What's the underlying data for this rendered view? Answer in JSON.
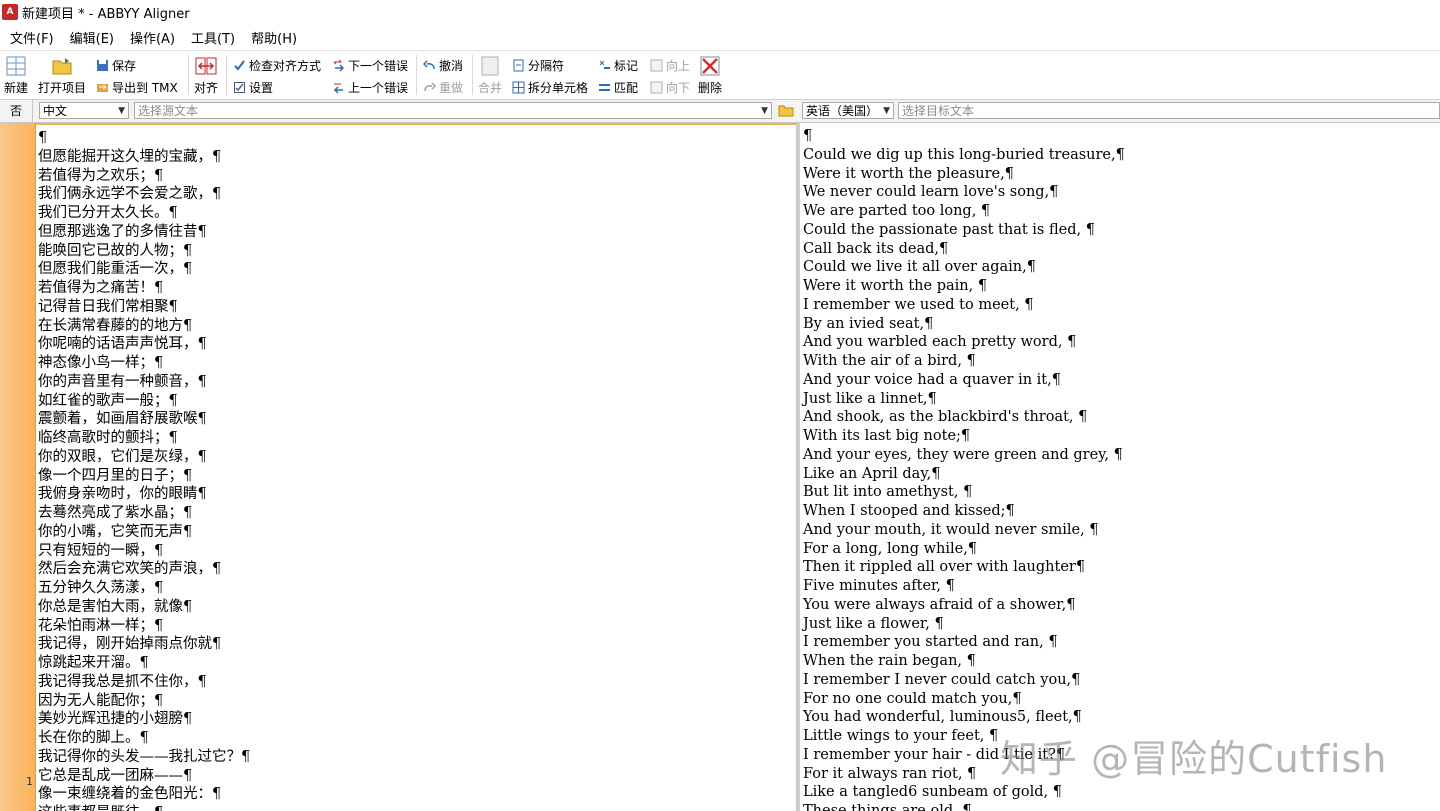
{
  "window": {
    "title": "新建项目 * - ABBYY Aligner",
    "icon": "app-icon"
  },
  "menu": [
    "文件(F)",
    "编辑(E)",
    "操作(A)",
    "工具(T)",
    "帮助(H)"
  ],
  "toolbar": {
    "new": "新建",
    "open": "打开项目",
    "save": "保存",
    "export_tmx": "导出到 TMX",
    "align": "对齐",
    "check_alignment": "检查对齐方式",
    "settings": "设置",
    "next_error": "下一个错误",
    "prev_error": "上一个错误",
    "undo": "撤消",
    "redo": "重做",
    "merge": "合并",
    "separator": "分隔符",
    "split_cells": "拆分单元格",
    "mark": "标记",
    "match": "匹配",
    "up": "向上",
    "down": "向下",
    "delete": "删除"
  },
  "selector": {
    "no_label": "否",
    "source_lang": "中文",
    "source_placeholder": "选择源文本",
    "target_lang": "英语（美国）",
    "target_placeholder": "选择目标文本"
  },
  "row_number": "1",
  "source_lines": [
    "¶",
    "但愿能掘开这久埋的宝藏，¶",
    "若值得为之欢乐；¶",
    "我们俩永远学不会爱之歌，¶",
    "我们已分开太久长。¶",
    "但愿那逃逸了的多情往昔¶",
    "能唤回它已故的人物；¶",
    "但愿我们能重活一次，¶",
    "若值得为之痛苦！¶",
    "记得昔日我们常相聚¶",
    "在长满常春藤的的地方¶",
    "你呢喃的话语声声悦耳，¶",
    "神态像小鸟一样；¶",
    "你的声音里有一种颤音，¶",
    "如红雀的歌声一般；¶",
    "震颤着，如画眉舒展歌喉¶",
    "临终高歌时的颤抖；¶",
    "你的双眼，它们是灰绿，¶",
    "像一个四月里的日子；¶",
    "我俯身亲吻时，你的眼睛¶",
    "去蓦然亮成了紫水晶；¶",
    "你的小嘴，它笑而无声¶",
    "只有短短的一瞬，¶",
    "然后会充满它欢笑的声浪，¶",
    "五分钟久久荡漾，¶",
    "你总是害怕大雨，就像¶",
    "花朵怕雨淋一样；¶",
    "我记得，刚开始掉雨点你就¶",
    "惊跳起来开溜。¶",
    "我记得我总是抓不住你，¶",
    "因为无人能配你；¶",
    "美妙光辉迅捷的小翅膀¶",
    "长在你的脚上。¶",
    "我记得你的头发——我扎过它？¶",
    "它总是乱成一团麻——¶",
    "像一束缠绕着的金色阳光：¶",
    "这些事都是既往。¶"
  ],
  "target_lines": [
    "¶",
    "Could we dig up this long-buried treasure,¶",
    "Were it worth the pleasure,¶",
    "We never could learn love's song,¶",
    "We are parted too long, ¶",
    "Could the passionate past that is fled, ¶",
    "Call back its dead,¶",
    "Could we live it all over again,¶",
    "Were it worth the pain, ¶",
    "I remember we used to meet, ¶",
    "By an ivied seat,¶",
    "And you warbled each pretty word, ¶",
    "With the air of a bird, ¶",
    "And your voice had a quaver in it,¶",
    "Just like a linnet,¶",
    "And shook, as the blackbird's throat, ¶",
    "With its last big note;¶",
    "And your eyes, they were green and grey, ¶",
    "Like an April day,¶",
    "But lit into amethyst, ¶",
    "When I stooped and kissed;¶",
    "And your mouth, it would never smile, ¶",
    "For a long, long while,¶",
    "Then it rippled all over with laughter¶",
    "Five minutes after, ¶",
    "You were always afraid of a shower,¶",
    "Just like a flower, ¶",
    "I remember you started and ran, ¶",
    "When the rain began, ¶",
    "I remember I never could catch you,¶",
    "For no one could match you,¶",
    "You had wonderful, luminous5, fleet,¶",
    "Little wings to your feet, ¶",
    "I remember your hair - did I tie it?¶",
    "For it always ran riot, ¶",
    "Like a tangled6 sunbeam of gold, ¶",
    "These things are old, ¶"
  ],
  "watermark": "知乎 @冒险的Cutfish"
}
